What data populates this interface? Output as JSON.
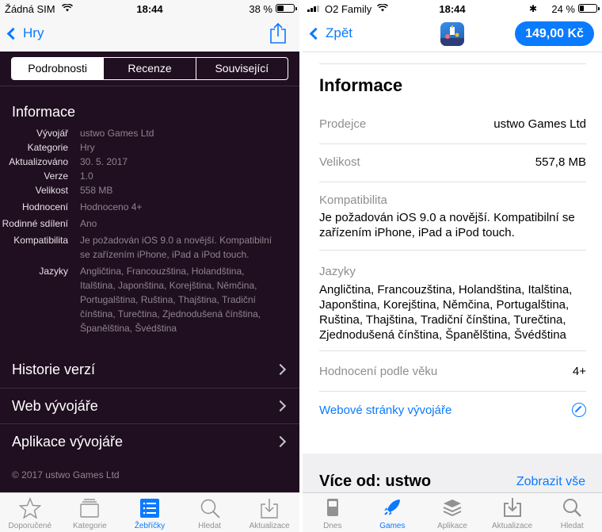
{
  "left": {
    "status": {
      "carrier": "Žádná SIM",
      "time": "18:44",
      "battery": "38 %",
      "battery_level": 0.38
    },
    "nav": {
      "back_label": "Hry"
    },
    "segments": [
      "Podrobnosti",
      "Recenze",
      "Související"
    ],
    "info_title": "Informace",
    "info_rows": [
      {
        "k": "Vývojář",
        "v": "ustwo Games Ltd"
      },
      {
        "k": "Kategorie",
        "v": "Hry"
      },
      {
        "k": "Aktualizováno",
        "v": "30. 5. 2017"
      },
      {
        "k": "Verze",
        "v": "1.0"
      },
      {
        "k": "Velikost",
        "v": "558 MB"
      },
      {
        "k": "Hodnocení",
        "v": "Hodnoceno 4+"
      },
      {
        "k": "Rodinné sdílení",
        "v": "Ano"
      },
      {
        "k": "Kompatibilita",
        "v": "Je požadován iOS 9.0 a novější. Kompatibilní se zařízením iPhone, iPad a iPod touch."
      },
      {
        "k": "Jazyky",
        "v": "Angličtina, Francouzština, Holandština, Italština, Japonština, Korejština, Němčina, Portugalština, Ruština, Thajština, Tradiční čínština, Turečtina, Zjednodušená čínština, Španělština, Švédština"
      }
    ],
    "links": [
      "Historie verzí",
      "Web vývojáře",
      "Aplikace vývojáře"
    ],
    "copyright": "© 2017 ustwo Games Ltd",
    "tabs": [
      {
        "label": "Doporučené",
        "icon": "star-icon"
      },
      {
        "label": "Kategorie",
        "icon": "categories-icon"
      },
      {
        "label": "Žebříčky",
        "icon": "top-charts-icon"
      },
      {
        "label": "Hledat",
        "icon": "search-icon"
      },
      {
        "label": "Aktualizace",
        "icon": "updates-icon"
      }
    ],
    "active_tab": 2
  },
  "right": {
    "status": {
      "carrier": "O2 Family",
      "time": "18:44",
      "battery": "24 %",
      "battery_level": 0.24
    },
    "nav": {
      "back_label": "Zpět",
      "price": "149,00 Kč"
    },
    "info_title": "Informace",
    "seller": {
      "k": "Prodejce",
      "v": "ustwo Games Ltd"
    },
    "size": {
      "k": "Velikost",
      "v": "557,8 MB"
    },
    "compat": {
      "k": "Kompatibilita",
      "v": "Je požadován iOS 9.0 a novější. Kompatibilní se zařízením iPhone, iPad a  iPod touch."
    },
    "languages": {
      "k": "Jazyky",
      "v": "Angličtina, Francouzština, Holandština, Italština, Japonština, Korejština, Němčina, Portugalština, Ruština, Thajština, Tradiční čínština, Turečtina, Zjednodušená čínština, Španělština, Švédština"
    },
    "age": {
      "k": "Hodnocení podle věku",
      "v": "4+"
    },
    "website_label": "Webové stránky vývojáře",
    "more": {
      "title": "Více od: ustwo",
      "link": "Zobrazit vše"
    },
    "tabs": [
      {
        "label": "Dnes",
        "icon": "today-icon"
      },
      {
        "label": "Games",
        "icon": "games-rocket-icon"
      },
      {
        "label": "Aplikace",
        "icon": "apps-layers-icon"
      },
      {
        "label": "Aktualizace",
        "icon": "updates-icon"
      },
      {
        "label": "Hledat",
        "icon": "search-icon"
      }
    ],
    "active_tab": 1
  },
  "colors": {
    "accent": "#0a7aff",
    "left_bg": "#200f20",
    "right_bg": "#ffffff"
  }
}
